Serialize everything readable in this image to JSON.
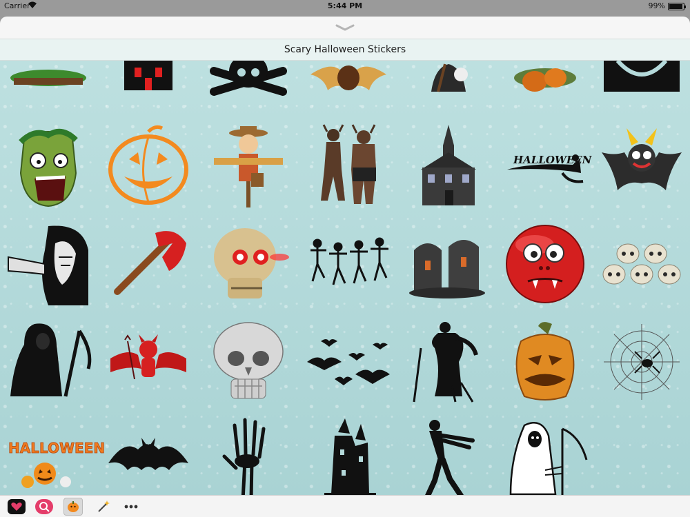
{
  "status": {
    "carrier": "Carrier",
    "time": "5:44 PM",
    "battery": "99%",
    "battery_level": 0.99
  },
  "header": {
    "title": "Scary Halloween Stickers"
  },
  "stickers": [
    "swamp-ground-icon",
    "haunted-house-icon",
    "skull-crossbones-icon",
    "bat-icon",
    "witch-icon",
    "pumpkin-pile-icon",
    "black-cat-icon",
    "zombie-head-icon",
    "jack-o-lantern-outline-icon",
    "scarecrow-icon",
    "demons-icon",
    "haunted-house-icon",
    "halloween-witch-banner-icon",
    "cartoon-bat-icon",
    "ghoul-woman-icon",
    "axe-icon",
    "glowing-skull-icon",
    "dancing-skeletons-icon",
    "tombstones-icon",
    "red-vampire-face-icon",
    "skull-pile-icon",
    "grim-reaper-silhouette-icon",
    "red-devil-icon",
    "skull-icon",
    "bats-icon",
    "zombie-silhouette-icon",
    "angry-pumpkin-icon",
    "spider-web-icon",
    "happy-halloween-sign-icon",
    "bat-silhouette-icon",
    "skeleton-hand-icon",
    "haunted-castle-icon",
    "walking-zombie-icon",
    "reaper-sketch-icon"
  ],
  "app_drawer": [
    "heart-icon",
    "search-icon",
    "pumpkin-icon",
    "magic-wand-icon",
    "more-icon"
  ],
  "colors": {
    "background": "#b5dadb",
    "header": "#e9f3f2",
    "accent": "#e43d6a",
    "pumpkin": "#f38a1f"
  }
}
